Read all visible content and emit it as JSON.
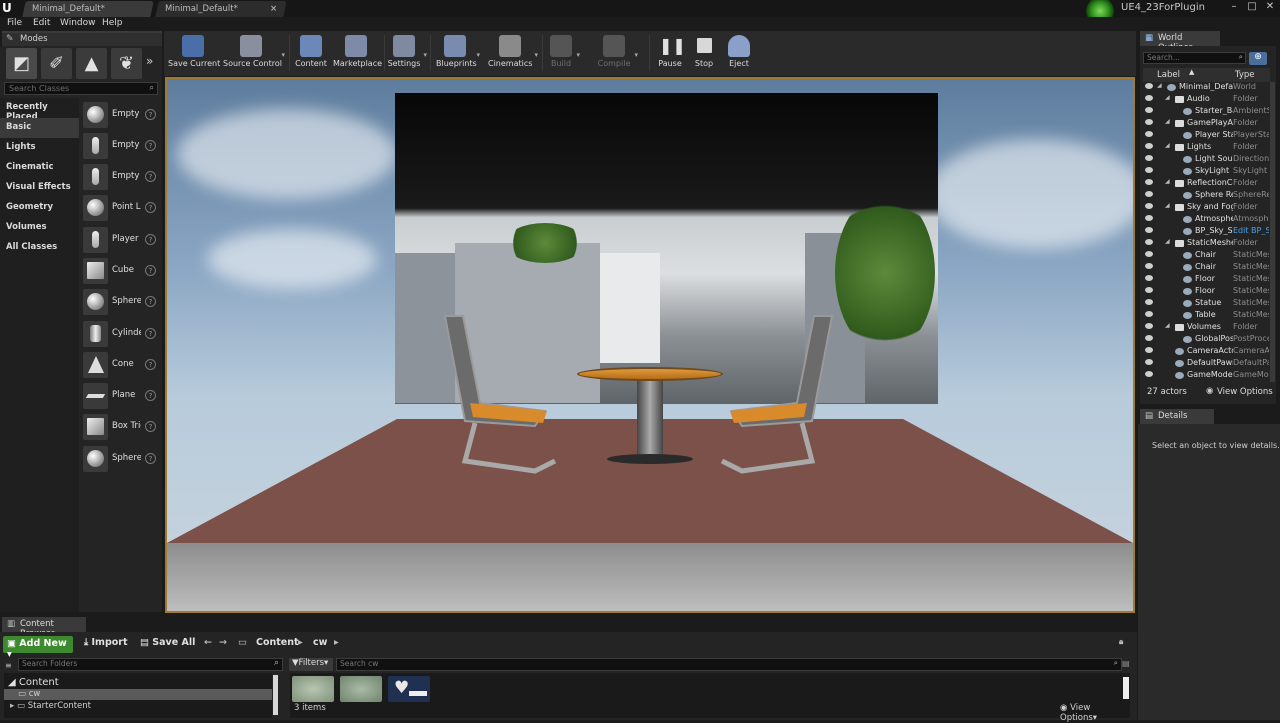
{
  "titlebar": {
    "tabs": [
      {
        "label": "Minimal_Default*"
      },
      {
        "label": "Minimal_Default*"
      }
    ],
    "project_name": "UE4_23ForPlugin",
    "window_buttons": [
      "minimize-icon",
      "maximize-icon",
      "close-icon"
    ]
  },
  "menu": [
    "File",
    "Edit",
    "Window",
    "Help"
  ],
  "modes": {
    "tab_label": "Modes",
    "mode_buttons": [
      "place-mode-icon",
      "paint-mode-icon",
      "landscape-mode-icon",
      "foliage-mode-icon"
    ],
    "search_placeholder": "Search Classes",
    "categories": [
      "Recently Placed",
      "Basic",
      "Lights",
      "Cinematic",
      "Visual Effects",
      "Geometry",
      "Volumes",
      "All Classes"
    ],
    "selected_category": "Basic",
    "items": [
      {
        "label": "Empty Actor"
      },
      {
        "label": "Empty Character"
      },
      {
        "label": "Empty Pawn"
      },
      {
        "label": "Point Light"
      },
      {
        "label": "Player Start"
      },
      {
        "label": "Cube"
      },
      {
        "label": "Sphere"
      },
      {
        "label": "Cylinder"
      },
      {
        "label": "Cone"
      },
      {
        "label": "Plane"
      },
      {
        "label": "Box Trigger"
      },
      {
        "label": "Sphere Trigger"
      }
    ]
  },
  "toolbar": {
    "buttons": [
      {
        "label": "Save Current",
        "icon": "save-icon",
        "color": "#4a6fa8"
      },
      {
        "label": "Source Control",
        "icon": "source-control-icon",
        "color": "#8a8fa0"
      },
      {
        "label": "Content",
        "icon": "content-icon",
        "color": "#6b88b8"
      },
      {
        "label": "Marketplace",
        "icon": "marketplace-icon",
        "color": "#7d8aa8"
      },
      {
        "label": "Settings",
        "icon": "settings-icon",
        "color": "#7f8aa0"
      },
      {
        "label": "Blueprints",
        "icon": "blueprints-icon",
        "color": "#7a8bb0"
      },
      {
        "label": "Cinematics",
        "icon": "cinematics-icon",
        "color": "#8a8a8a"
      },
      {
        "label": "Build",
        "icon": "build-icon",
        "color": "#555555"
      },
      {
        "label": "Compile",
        "icon": "compile-icon",
        "color": "#555555"
      },
      {
        "label": "Pause",
        "icon": "pause-icon",
        "color": "#cfcfcf"
      },
      {
        "label": "Stop",
        "icon": "stop-icon",
        "color": "#cfcfcf"
      },
      {
        "label": "Eject",
        "icon": "eject-icon",
        "color": "#8aa0c8"
      }
    ]
  },
  "world_outliner": {
    "tab_label": "World Outliner",
    "search_placeholder": "Search...",
    "columns": {
      "label": "Label",
      "type": "Type"
    },
    "rows": [
      {
        "label": "Minimal_Default (Editor)",
        "type": "World"
      },
      {
        "label": "Audio",
        "type": "Folder"
      },
      {
        "label": "Starter_Background_Cue",
        "type": "AmbientSound"
      },
      {
        "label": "GamePlayActors",
        "type": "Folder"
      },
      {
        "label": "Player Start",
        "type": "PlayerStart"
      },
      {
        "label": "Lights",
        "type": "Folder"
      },
      {
        "label": "Light Source",
        "type": "DirectionalLight"
      },
      {
        "label": "SkyLight",
        "type": "SkyLight"
      },
      {
        "label": "ReflectionCaptureActors",
        "type": "Folder"
      },
      {
        "label": "Sphere Reflection Capture",
        "type": "SphereReflectionCapture"
      },
      {
        "label": "Sky and Fog",
        "type": "Folder"
      },
      {
        "label": "Atmospheric Fog",
        "type": "AtmosphericFog"
      },
      {
        "label": "BP_Sky_Sphere",
        "type": "Edit BP_Sky_Sphere"
      },
      {
        "label": "StaticMeshes",
        "type": "Folder"
      },
      {
        "label": "Chair",
        "type": "StaticMeshActor"
      },
      {
        "label": "Chair",
        "type": "StaticMeshActor"
      },
      {
        "label": "Floor",
        "type": "StaticMeshActor"
      },
      {
        "label": "Floor",
        "type": "StaticMeshActor"
      },
      {
        "label": "Statue",
        "type": "StaticMeshActor"
      },
      {
        "label": "Table",
        "type": "StaticMeshActor"
      },
      {
        "label": "Volumes",
        "type": "Folder"
      },
      {
        "label": "GlobalPostProcessVolume",
        "type": "PostProcessVolume"
      },
      {
        "label": "CameraActor",
        "type": "CameraActor"
      },
      {
        "label": "DefaultPawn",
        "type": "DefaultPawn"
      },
      {
        "label": "GameModeBase",
        "type": "GameModeBase"
      }
    ],
    "actor_count": "27 actors",
    "view_options": "View Options"
  },
  "details": {
    "tab_label": "Details",
    "empty_message": "Select an object to view details."
  },
  "content_browser": {
    "tab_label": "Content Browser",
    "add_new": "Add New",
    "import": "Import",
    "save_all": "Save All",
    "breadcrumb": [
      "Content",
      "cw"
    ],
    "folder_search_placeholder": "Search Folders",
    "filters_label": "Filters",
    "asset_search_placeholder": "Search cw",
    "tree": [
      {
        "label": "Content"
      },
      {
        "label": "cw"
      },
      {
        "label": "StarterContent"
      }
    ],
    "item_count": "3 items",
    "view_options": "View Options",
    "assets": [
      {
        "icon": "material-thumbnail-icon",
        "color": "#9aa89a"
      },
      {
        "icon": "material-thumbnail-icon",
        "color": "#8fa08f"
      },
      {
        "icon": "heart-thumbnail-icon",
        "color": "#203050"
      }
    ]
  }
}
